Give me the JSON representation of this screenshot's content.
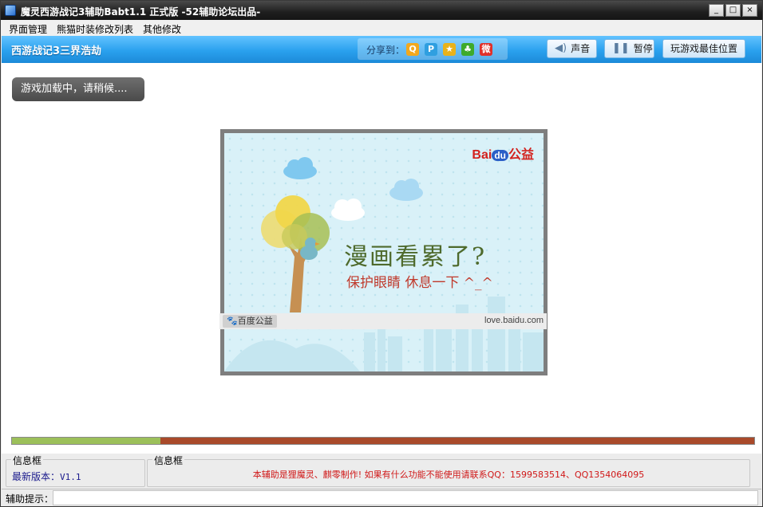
{
  "window": {
    "title": "魔灵西游战记3辅助Babt1.1 正式版 -52辅助论坛出品-",
    "min_label": "_",
    "max_label": "□",
    "close_label": "×"
  },
  "menu": {
    "items": [
      {
        "label": "界面管理"
      },
      {
        "label": "熊猫时装修改列表"
      },
      {
        "label": "其他修改"
      }
    ]
  },
  "toolbar": {
    "game_name": "西游战记3三界浩劫",
    "share_label": "分享到：",
    "share_icons": [
      {
        "name": "qq-icon",
        "glyph": "Q",
        "color": "#f2a81d"
      },
      {
        "name": "qzone-icon",
        "glyph": "P",
        "color": "#2f9fe0"
      },
      {
        "name": "star-icon",
        "glyph": "★",
        "color": "#e9b21a"
      },
      {
        "name": "clover-icon",
        "glyph": "♣",
        "color": "#3eaa2b"
      },
      {
        "name": "weibo-icon",
        "glyph": "微",
        "color": "#e0312b"
      }
    ],
    "sound_label": "声音",
    "pause_label": "暂停",
    "best_position_label": "玩游戏最佳位置"
  },
  "content": {
    "loading_text": "游戏加载中，请稍候....",
    "ad": {
      "brand": "Bai",
      "brand_du": "du",
      "brand_suffix": "公益",
      "headline": "漫画看累了?",
      "subline": "保护眼睛 休息一下 ^_^",
      "badge": "百度公益",
      "url": "love.baidu.com"
    },
    "progress": 0.2
  },
  "info": {
    "group1_title": "信息框",
    "version_label": "最新版本：",
    "version_value": "V1.1",
    "group2_title": "信息框",
    "notice": "本辅助是狸魔灵、麒零制作!  如果有什么功能不能使用请联系QQ：1599583514、QQ1354064095"
  },
  "status": {
    "label": "辅助提示："
  }
}
